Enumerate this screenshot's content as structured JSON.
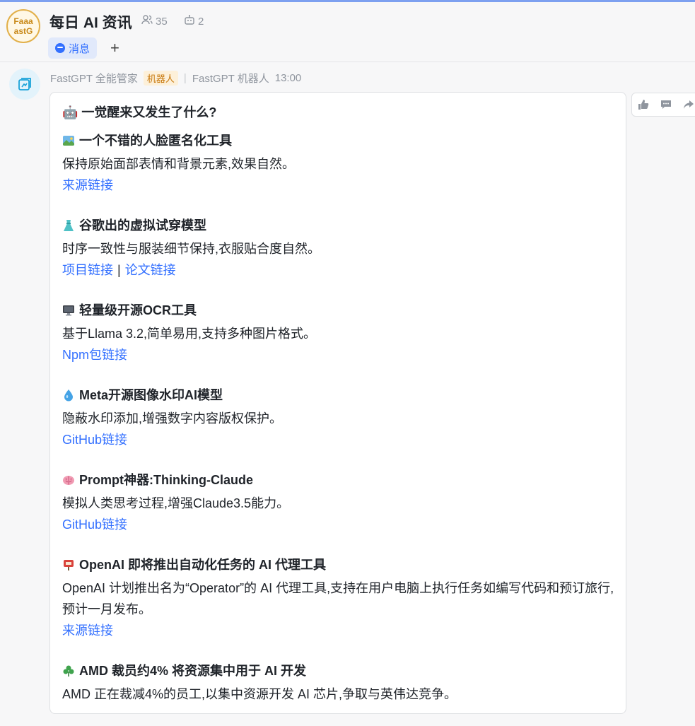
{
  "header": {
    "avatar_text_1": "Faaa",
    "avatar_text_2": "astG",
    "title": "每日 AI 资讯",
    "member_count": "35",
    "bot_count": "2",
    "tab_label": "消息",
    "add_tab": "+"
  },
  "message": {
    "sender": "FastGPT 全能管家",
    "tag": "机器人",
    "separator": "|",
    "bot_name": "FastGPT 机器人",
    "time": "13:00",
    "headline": "🤖 一觉醒来又发生了什么?",
    "items": [
      {
        "icon": "picture-icon",
        "title": "一个不错的人脸匿名化工具",
        "desc": "保持原始面部表情和背景元素,效果自然。",
        "links": [
          "来源链接"
        ]
      },
      {
        "icon": "dress-icon",
        "title": "谷歌出的虚拟试穿模型",
        "desc": "时序一致性与服装细节保持,衣服贴合度自然。",
        "links": [
          "项目链接",
          "论文链接"
        ],
        "link_separator": "|"
      },
      {
        "icon": "monitor-icon",
        "title": "轻量级开源OCR工具",
        "desc": "基于Llama 3.2,简单易用,支持多种图片格式。",
        "links": [
          "Npm包链接"
        ]
      },
      {
        "icon": "droplet-icon",
        "title": "Meta开源图像水印AI模型",
        "desc": "隐蔽水印添加,增强数字内容版权保护。",
        "links": [
          "GitHub链接"
        ]
      },
      {
        "icon": "brain-icon",
        "title": "Prompt神器:Thinking-Claude",
        "desc": "模拟人类思考过程,增强Claude3.5能力。",
        "links": [
          "GitHub链接"
        ]
      },
      {
        "icon": "mailbox-icon",
        "title": "OpenAI 即将推出自动化任务的 AI 代理工具",
        "desc": "OpenAI 计划推出名为“Operator”的 AI 代理工具,支持在用户电脑上执行任务如编写代码和预订旅行,预计一月发布。",
        "links": [
          "来源链接"
        ]
      },
      {
        "icon": "shamrock-icon",
        "title": "AMD 裁员约4% 将资源集中用于 AI 开发",
        "desc": "AMD 正在裁减4%的员工,以集中资源开发 AI 芯片,争取与英伟达竞争。",
        "links": []
      }
    ]
  },
  "colors": {
    "accent": "#3370ff",
    "tag_bg": "#fdf0d9",
    "tag_text": "#c7770b",
    "avatar_ring": "#e2b04a"
  }
}
